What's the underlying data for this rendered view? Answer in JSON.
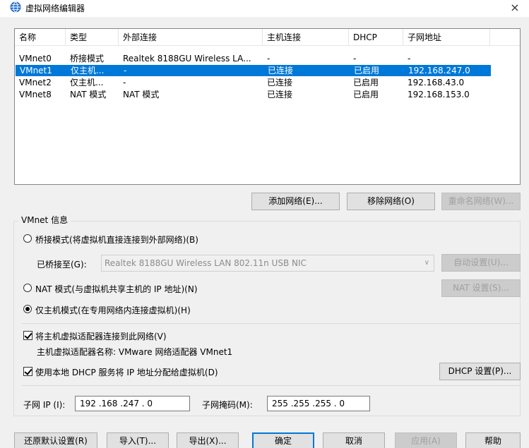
{
  "window": {
    "title": "虚拟网络编辑器",
    "close": "×"
  },
  "list": {
    "headers": [
      "名称",
      "类型",
      "外部连接",
      "主机连接",
      "DHCP",
      "子网地址"
    ],
    "rows": [
      [
        "VMnet0",
        "桥接模式",
        "Realtek 8188GU Wireless LA...",
        "-",
        "-",
        "-"
      ],
      [
        "VMnet1",
        "仅主机...",
        "-",
        "已连接",
        "已启用",
        "192.168.247.0"
      ],
      [
        "VMnet2",
        "仅主机...",
        "-",
        "已连接",
        "已启用",
        "192.168.43.0"
      ],
      [
        "VMnet8",
        "NAT 模式",
        "NAT 模式",
        "已连接",
        "已启用",
        "192.168.153.0"
      ]
    ],
    "selected_row": 1
  },
  "list_buttons": {
    "add": "添加网络(E)...",
    "remove": "移除网络(O)",
    "rename": "重命名网络(W)..."
  },
  "vmnet_info": {
    "group_title": "VMnet 信息",
    "bridged_radio": "桥接模式(将虚拟机直接连接到外部网络)(B)",
    "bridged_to_label": "已桥接至(G):",
    "bridged_to_value": "Realtek 8188GU Wireless LAN 802.11n USB NIC",
    "auto_settings": "自动设置(U)...",
    "nat_radio": "NAT 模式(与虚拟机共享主机的 IP 地址)(N)",
    "nat_settings": "NAT 设置(S)...",
    "hostonly_radio": "仅主机模式(在专用网络内连接虚拟机)(H)",
    "connect_adapter_check": "将主机虚拟适配器连接到此网络(V)",
    "adapter_name": "主机虚拟适配器名称: VMware 网络适配器 VMnet1",
    "dhcp_check": "使用本地 DHCP 服务将 IP 地址分配给虚拟机(D)",
    "dhcp_settings": "DHCP 设置(P)...",
    "subnet_ip_label": "子网 IP (I):",
    "subnet_ip_value": "192 .168 .247 . 0",
    "subnet_mask_label": "子网掩码(M):",
    "subnet_mask_value": "255 .255 .255 . 0"
  },
  "footer": {
    "restore": "还原默认设置(R)",
    "import": "导入(T)...",
    "export": "导出(X)...",
    "ok": "确定",
    "cancel": "取消",
    "apply": "应用(A)",
    "help": "帮助"
  }
}
